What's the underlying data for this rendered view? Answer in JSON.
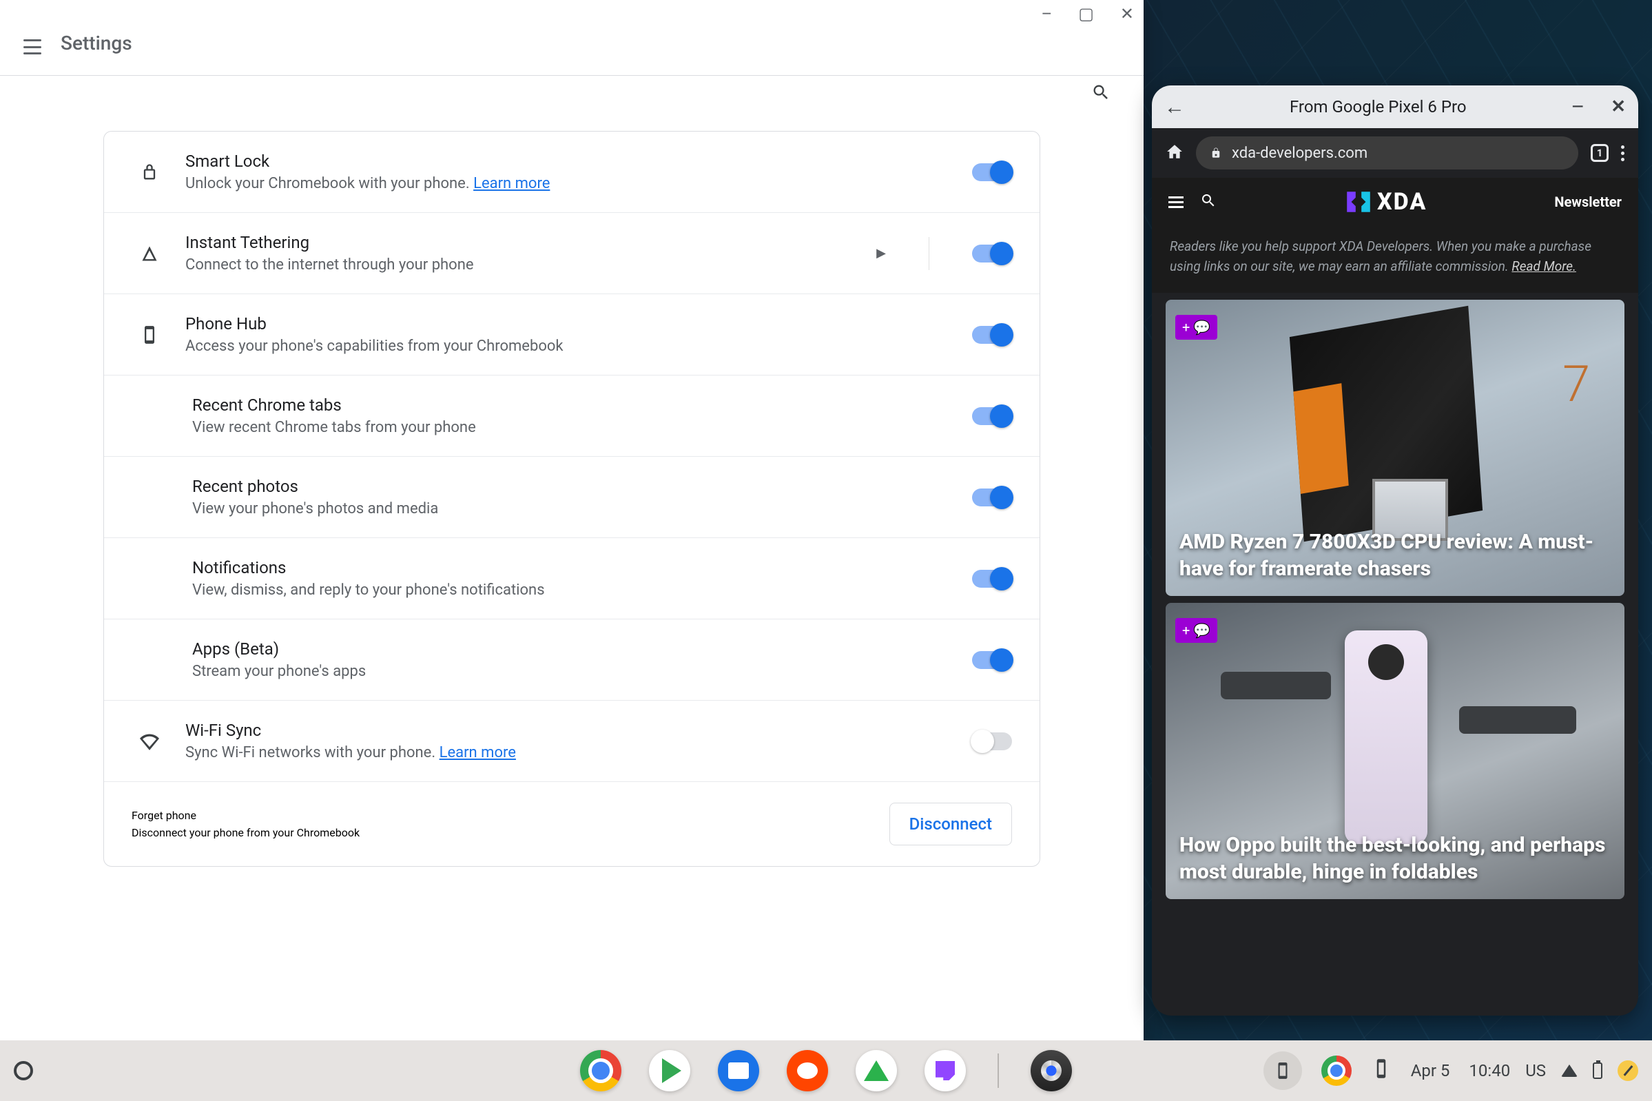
{
  "settings": {
    "title": "Settings",
    "rows": {
      "smart_lock": {
        "title": "Smart Lock",
        "desc": "Unlock your Chromebook with your phone. ",
        "link": "Learn more",
        "on": true
      },
      "tether": {
        "title": "Instant Tethering",
        "desc": "Connect to the internet through your phone",
        "on": true
      },
      "phone_hub": {
        "title": "Phone Hub",
        "desc": "Access your phone's capabilities from your Chromebook",
        "on": true
      },
      "recent_tabs": {
        "title": "Recent Chrome tabs",
        "desc": "View recent Chrome tabs from your phone",
        "on": true
      },
      "recent_photos": {
        "title": "Recent photos",
        "desc": "View your phone's photos and media",
        "on": true
      },
      "notifications": {
        "title": "Notifications",
        "desc": "View, dismiss, and reply to your phone's notifications",
        "on": true
      },
      "apps": {
        "title": "Apps (Beta)",
        "desc": "Stream your phone's apps",
        "on": true
      },
      "wifi_sync": {
        "title": "Wi-Fi Sync",
        "desc": "Sync Wi-Fi networks with your phone. ",
        "link": "Learn more",
        "on": false
      }
    },
    "footer": {
      "title": "Forget phone",
      "desc": "Disconnect your phone from your Chromebook",
      "button": "Disconnect"
    }
  },
  "phone_window": {
    "title": "From Google Pixel 6 Pro",
    "url": "xda-developers.com",
    "xda": {
      "brand": "XDA",
      "newsletter": "Newsletter",
      "affiliate_1": "Readers like you help support XDA Developers. When you make a purchase using links on our site, we may earn an affiliate commission. ",
      "affiliate_link": "Read More.",
      "article1": "AMD Ryzen 7 7800X3D CPU review: A must-have for framerate chasers",
      "article2": "How Oppo built the best-looking, and perhaps most durable, hinge in foldables"
    }
  },
  "shelf": {
    "date": "Apr 5",
    "time": "10:40",
    "locale": "US"
  }
}
